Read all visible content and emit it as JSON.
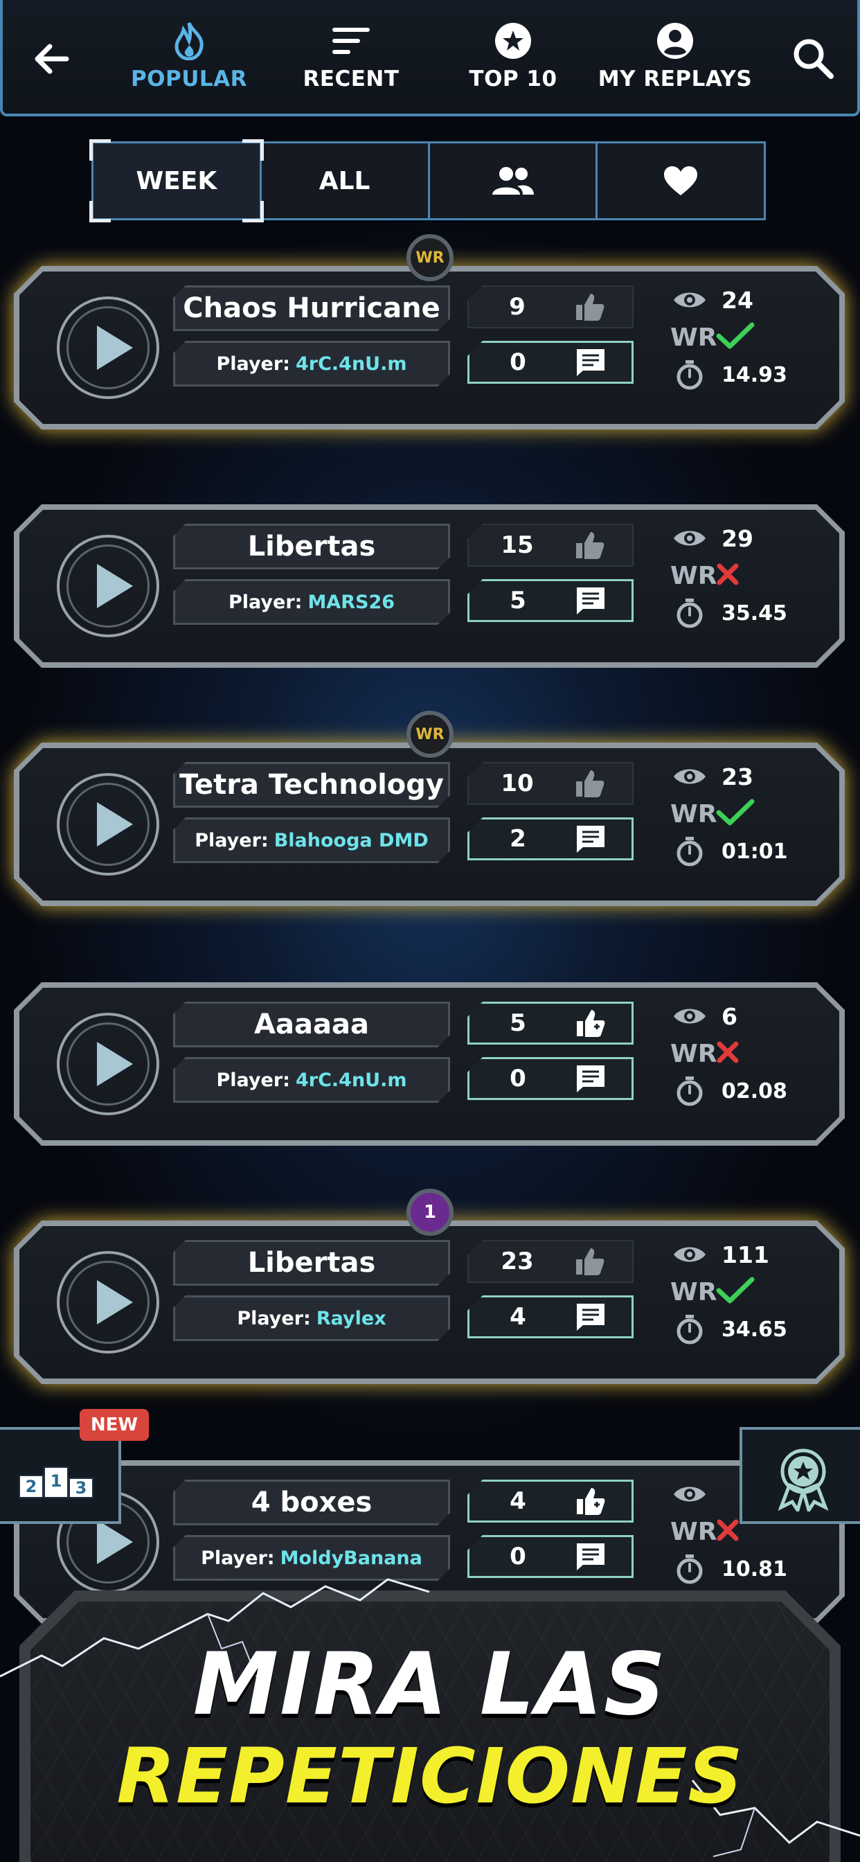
{
  "colors": {
    "accent": "#5bb4e6",
    "wr_gold": "#e1b83a",
    "player_name": "#6fe3ea",
    "check": "#3ecf57",
    "cross": "#e03a3a",
    "banner_yellow": "#f3ef2c"
  },
  "nav": {
    "back_icon": "arrow-left-icon",
    "search_icon": "search-icon",
    "tabs": [
      {
        "label": "POPULAR",
        "icon": "flame-icon",
        "active": true
      },
      {
        "label": "RECENT",
        "icon": "sort-lines-icon",
        "active": false
      },
      {
        "label": "TOP 10",
        "icon": "star-circle-icon",
        "active": false
      },
      {
        "label": "MY REPLAYS",
        "icon": "user-circle-icon",
        "active": false
      }
    ]
  },
  "filters": [
    {
      "label": "WEEK",
      "active": true
    },
    {
      "label": "ALL",
      "active": false
    },
    {
      "icon": "friends-icon"
    },
    {
      "icon": "heart-icon"
    }
  ],
  "player_prefix": "Player:",
  "wr_label": "WR",
  "replays": [
    {
      "badge": "WR",
      "title": "Chaos Hurricane",
      "player": "4rC.4nU.m",
      "likes": "9",
      "comments": "0",
      "views": "24",
      "wr": true,
      "time": "14.93"
    },
    {
      "badge": "",
      "title": "Libertas",
      "player": "MARS26",
      "likes": "15",
      "comments": "5",
      "views": "29",
      "wr": false,
      "time": "35.45"
    },
    {
      "badge": "WR",
      "title": "Tetra Technology",
      "player": "Blahooga DMD",
      "likes": "10",
      "comments": "2",
      "views": "23",
      "wr": true,
      "time": "01:01"
    },
    {
      "badge": "",
      "title": "Aaaaaa",
      "player": "4rC.4nU.m",
      "likes": "5",
      "comments": "0",
      "views": "6",
      "wr": false,
      "time": "02.08"
    },
    {
      "badge": "1",
      "title": "Libertas",
      "player": "Raylex",
      "likes": "23",
      "comments": "4",
      "views": "111",
      "wr": true,
      "time": "34.65"
    },
    {
      "badge": "",
      "title": "4 boxes",
      "player": "MoldyBanana",
      "likes": "4",
      "comments": "0",
      "views": "",
      "wr": false,
      "time": "10.81"
    }
  ],
  "side": {
    "new_label": "NEW",
    "left_icon": "podium-icon",
    "right_icon": "award-ribbon-icon"
  },
  "banner": {
    "line1": "MIRA LAS",
    "line2": "REPETICIONES"
  }
}
